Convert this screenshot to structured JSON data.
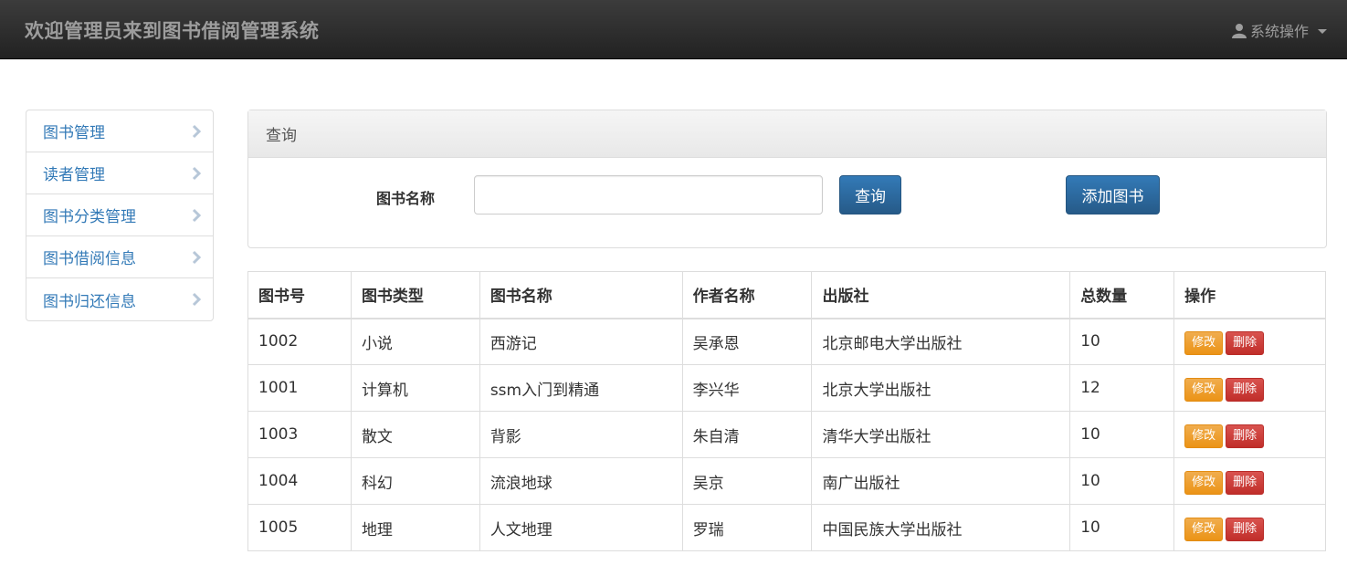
{
  "navbar": {
    "brand": "欢迎管理员来到图书借阅管理系统",
    "system_menu": "系统操作"
  },
  "sidebar": {
    "items": [
      {
        "label": "图书管理"
      },
      {
        "label": "读者管理"
      },
      {
        "label": "图书分类管理"
      },
      {
        "label": "图书借阅信息"
      },
      {
        "label": "图书归还信息"
      }
    ]
  },
  "search_panel": {
    "title": "查询",
    "field_label": "图书名称",
    "input_value": "",
    "query_button": "查询",
    "add_button": "添加图书"
  },
  "table": {
    "headers": [
      "图书号",
      "图书类型",
      "图书名称",
      "作者名称",
      "出版社",
      "总数量",
      "操作"
    ],
    "edit_label": "修改",
    "delete_label": "删除",
    "rows": [
      {
        "id": "1002",
        "type": "小说",
        "name": "西游记",
        "author": "吴承恩",
        "publisher": "北京邮电大学出版社",
        "count": "10"
      },
      {
        "id": "1001",
        "type": "计算机",
        "name": "ssm入门到精通",
        "author": "李兴华",
        "publisher": "北京大学出版社",
        "count": "12"
      },
      {
        "id": "1003",
        "type": "散文",
        "name": "背影",
        "author": "朱自清",
        "publisher": "清华大学出版社",
        "count": "10"
      },
      {
        "id": "1004",
        "type": "科幻",
        "name": "流浪地球",
        "author": "吴京",
        "publisher": "南广出版社",
        "count": "10"
      },
      {
        "id": "1005",
        "type": "地理",
        "name": "人文地理",
        "author": "罗瑞",
        "publisher": "中国民族大学出版社",
        "count": "10"
      }
    ]
  },
  "colors": {
    "navbar": "#222222",
    "link": "#337ab7",
    "primary": "#337ab7",
    "warning": "#f0ad4e",
    "danger": "#d9534f"
  }
}
